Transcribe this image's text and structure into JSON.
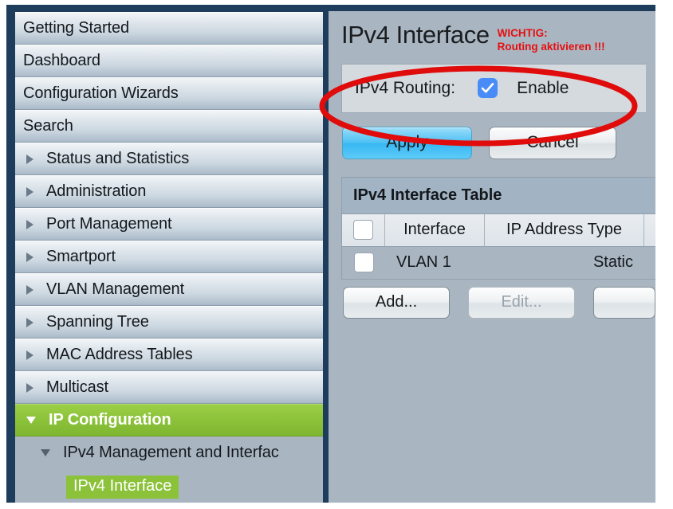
{
  "sidebar": {
    "items": [
      {
        "label": "Getting Started",
        "arrow": "none",
        "level": 0,
        "state": "normal"
      },
      {
        "label": "Dashboard",
        "arrow": "none",
        "level": 0,
        "state": "normal"
      },
      {
        "label": "Configuration Wizards",
        "arrow": "none",
        "level": 0,
        "state": "normal"
      },
      {
        "label": "Search",
        "arrow": "none",
        "level": 0,
        "state": "normal"
      },
      {
        "label": "Status and Statistics",
        "arrow": "right",
        "level": 0,
        "state": "normal"
      },
      {
        "label": "Administration",
        "arrow": "right",
        "level": 0,
        "state": "normal"
      },
      {
        "label": "Port Management",
        "arrow": "right",
        "level": 0,
        "state": "normal"
      },
      {
        "label": "Smartport",
        "arrow": "right",
        "level": 0,
        "state": "normal"
      },
      {
        "label": "VLAN Management",
        "arrow": "right",
        "level": 0,
        "state": "normal"
      },
      {
        "label": "Spanning Tree",
        "arrow": "right",
        "level": 0,
        "state": "normal"
      },
      {
        "label": "MAC Address Tables",
        "arrow": "right",
        "level": 0,
        "state": "normal"
      },
      {
        "label": "Multicast",
        "arrow": "right",
        "level": 0,
        "state": "normal"
      },
      {
        "label": "IP Configuration",
        "arrow": "down",
        "level": 0,
        "state": "selected"
      },
      {
        "label": "IPv4 Management and Interfac",
        "arrow": "down",
        "level": 1,
        "state": "plain"
      }
    ],
    "leaf": {
      "label": "IPv4 Interface",
      "state": "active"
    }
  },
  "content": {
    "page_title": "IPv4 Interface",
    "annotation": {
      "line1": "WICHTIG:",
      "line2": "Routing aktivieren !!!",
      "color": "#e50f0f"
    },
    "routing": {
      "label": "IPv4 Routing:",
      "checkbox_checked": true,
      "checkbox_color": "#4a8cf7",
      "enable_label": "Enable"
    },
    "buttons": {
      "apply": "Apply",
      "cancel": "Cancel"
    },
    "table": {
      "caption": "IPv4 Interface Table",
      "columns": [
        "",
        "Interface",
        "IP Address Type",
        ""
      ],
      "rows": [
        {
          "checked": false,
          "interface": "VLAN 1",
          "ip_address_type": "Static",
          "extra": ""
        }
      ],
      "buttons": {
        "add": "Add...",
        "edit": "Edit...",
        "edit_disabled": true,
        "third": ""
      }
    }
  },
  "colors": {
    "frame_navy": "#1e3d5c",
    "panel_bg": "#a9b6c2",
    "accent_green": "#8bc23a",
    "annotation_red": "#e50f0f",
    "apply_blue": "#4cc0f4"
  }
}
